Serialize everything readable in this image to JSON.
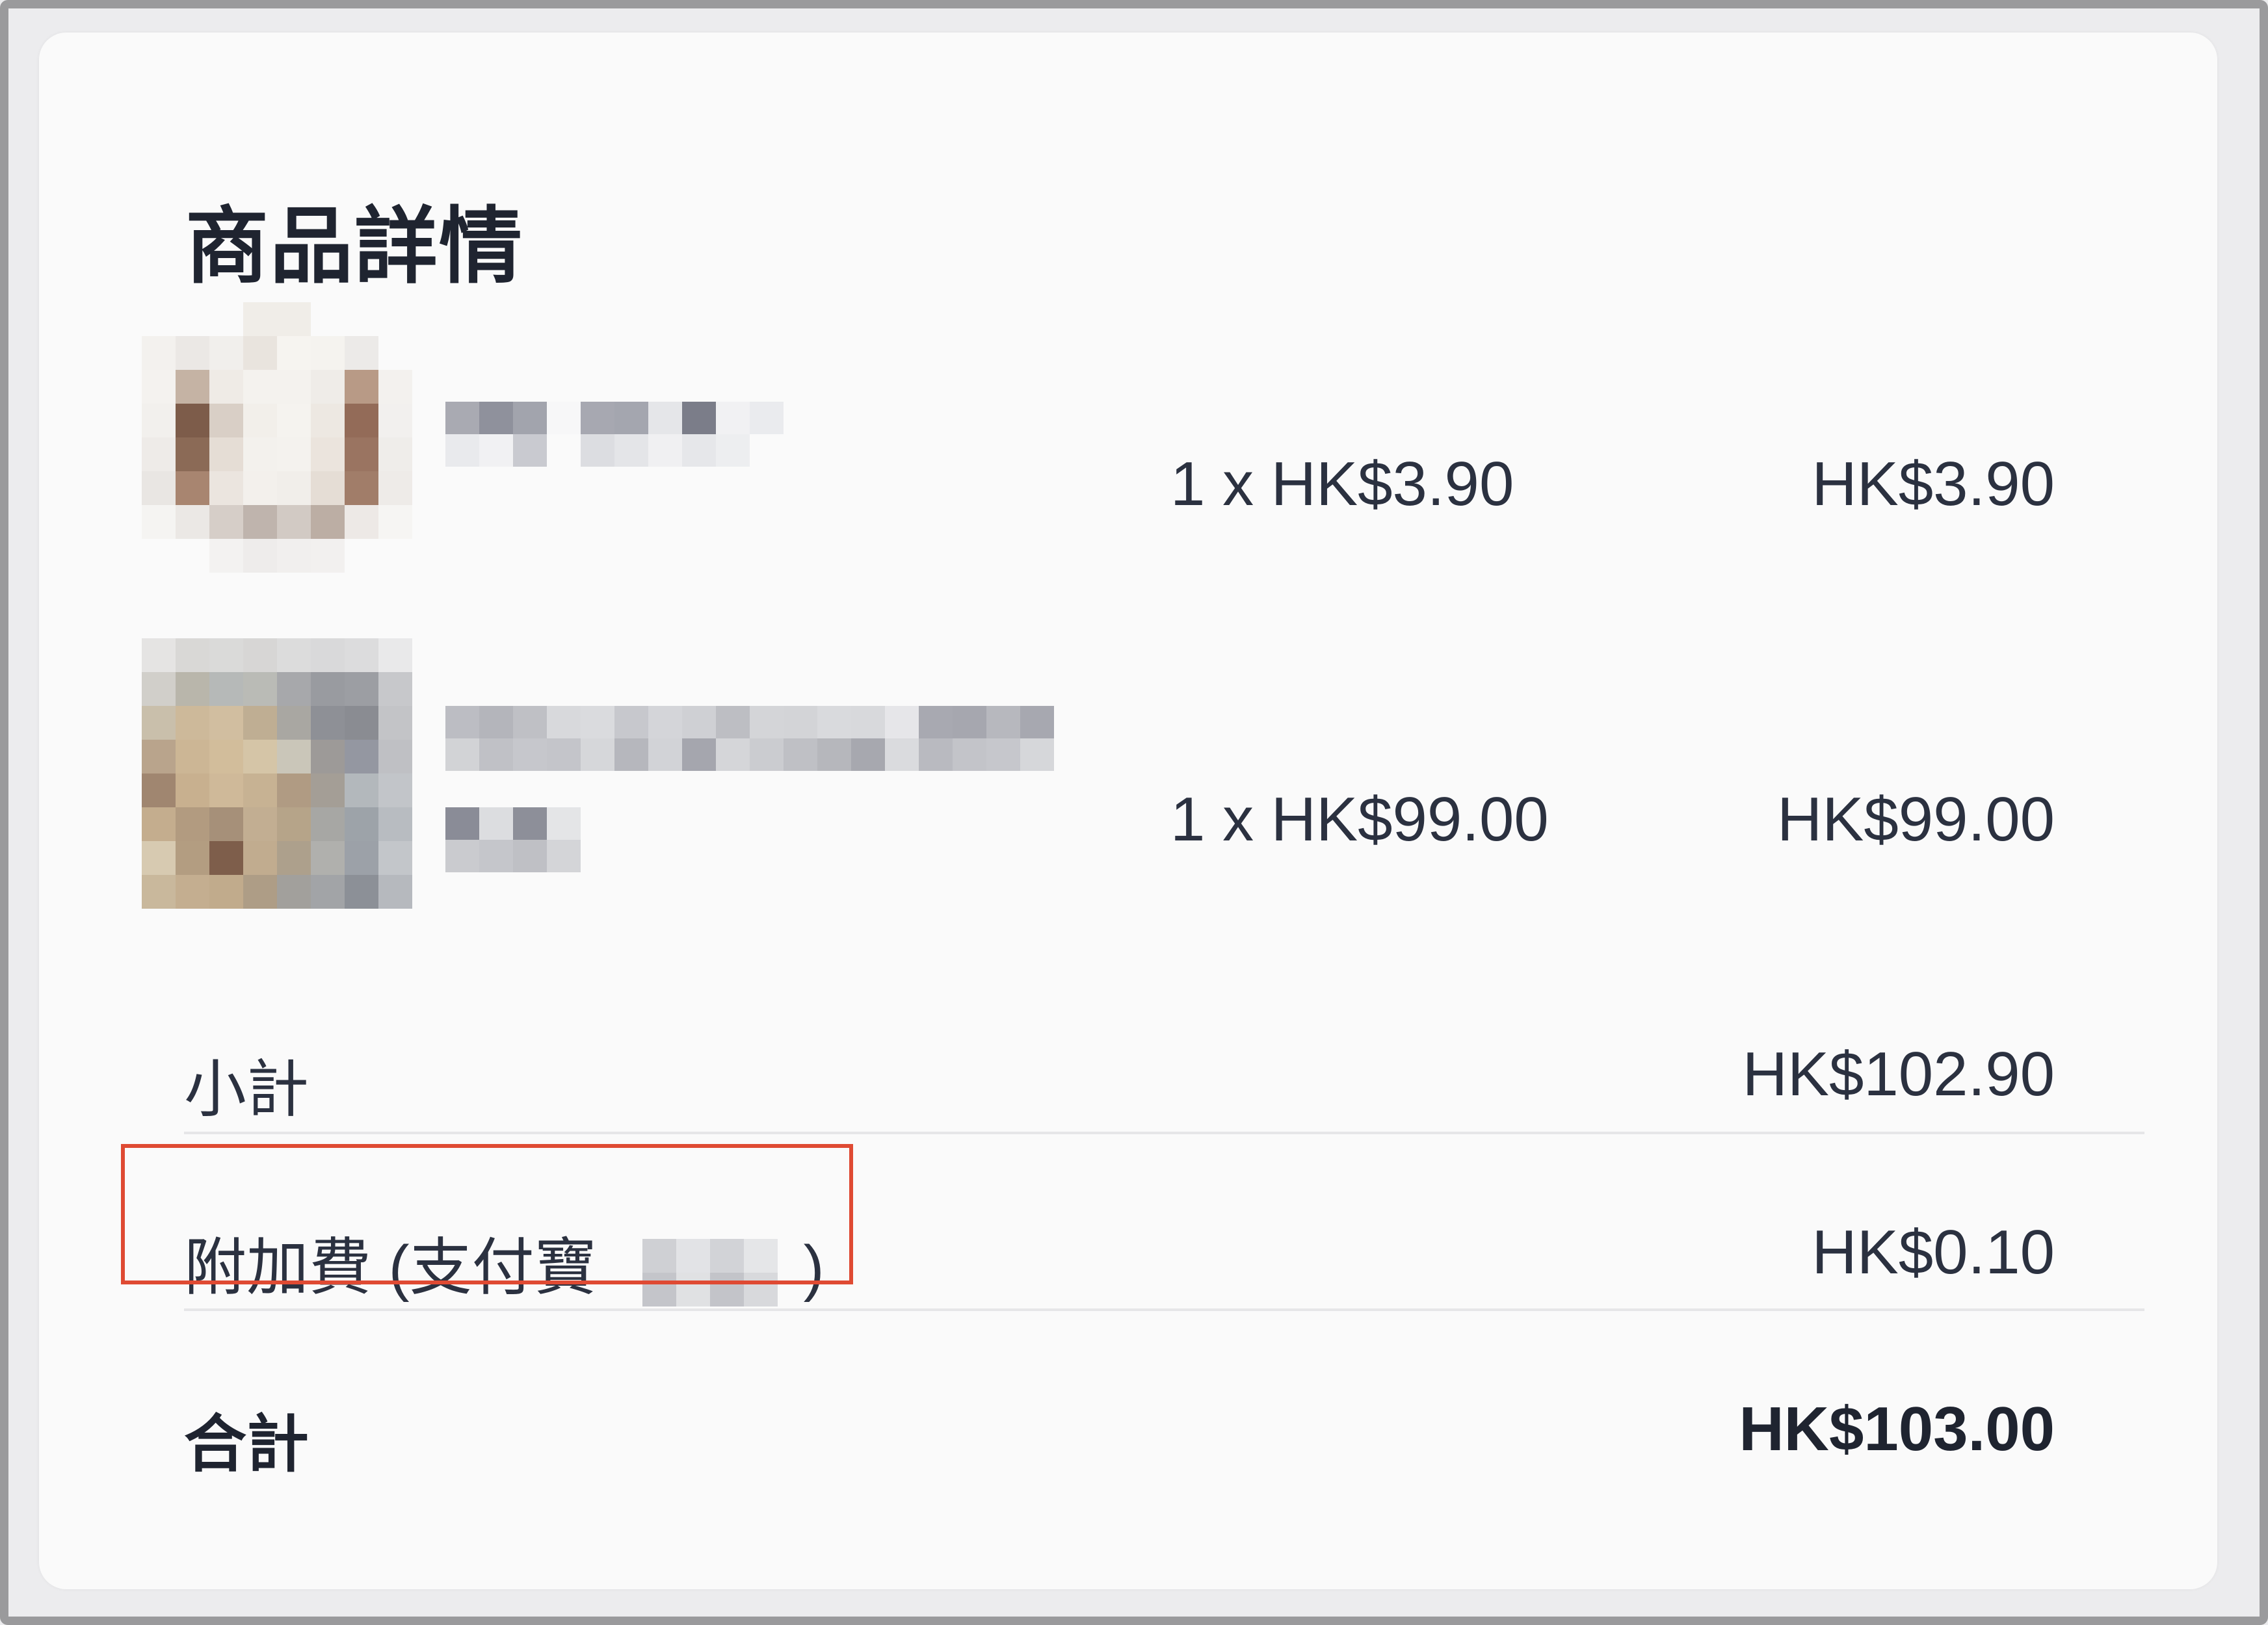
{
  "section": {
    "title": "商品詳情"
  },
  "items": [
    {
      "quantity_price": "1 x HK$3.90",
      "line_total": "HK$3.90"
    },
    {
      "quantity_price": "1 x HK$99.00",
      "line_total": "HK$99.00"
    }
  ],
  "summary": {
    "subtotal_label": "小計",
    "subtotal_value": "HK$102.90",
    "surcharge_label_prefix": "附加費 (支付寶",
    "surcharge_label_suffix": ")",
    "surcharge_value": "HK$0.10",
    "total_label": "合計",
    "total_value": "HK$103.00"
  },
  "colors": {
    "highlight_border": "#df4a33",
    "text": "#2b3140",
    "card_background": "#fafafa"
  }
}
